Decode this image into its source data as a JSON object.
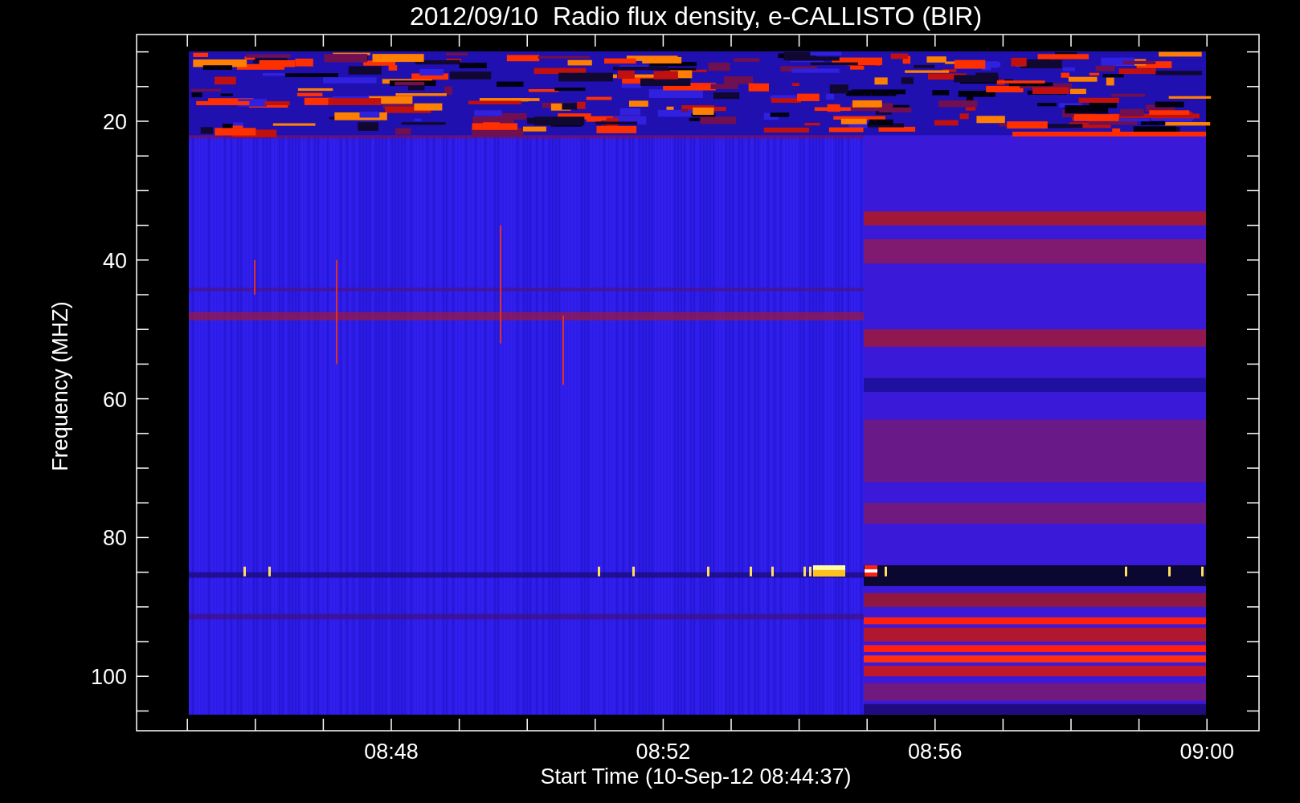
{
  "title": "2012/09/10  Radio flux density, e-CALLISTO (BIR)",
  "y_axis": {
    "label": "Frequency (MHZ)",
    "ticks": [
      "20",
      "40",
      "60",
      "80",
      "100"
    ]
  },
  "x_axis": {
    "label": "Start Time (10-Sep-12 08:44:37)",
    "ticks": [
      "08:48",
      "08:52",
      "08:56",
      "09:00"
    ]
  }
}
